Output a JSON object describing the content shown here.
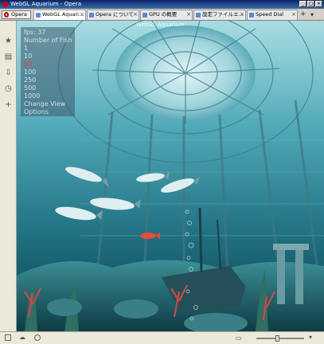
{
  "window": {
    "title": "WebGL Aquarium - Opera"
  },
  "opera_menu": {
    "label": "Opera"
  },
  "tabs": [
    {
      "label": "WebGL Aquari...",
      "active": true
    },
    {
      "label": "Opera について",
      "active": false
    },
    {
      "label": "GPU の概要",
      "active": false
    },
    {
      "label": "設定ファイルエ...",
      "active": false
    },
    {
      "label": "Speed Dial",
      "active": false
    }
  ],
  "sidebar": {
    "items": [
      "bookmarks-icon",
      "notes-icon",
      "downloads-icon",
      "history-icon",
      "add-panel-icon"
    ]
  },
  "page": {
    "caption": "WebGL Aquarium",
    "hud": {
      "fps": "fps: 37",
      "number_of_fish": "Number of Fish",
      "options": [
        "1",
        "10",
        "50",
        "100",
        "250",
        "500",
        "1000"
      ],
      "selected_option": "50",
      "change_view": "Change View",
      "options_label": "Options"
    }
  },
  "colors": {
    "selected_option": "#ff3030",
    "titlebar": "#0a246a"
  }
}
